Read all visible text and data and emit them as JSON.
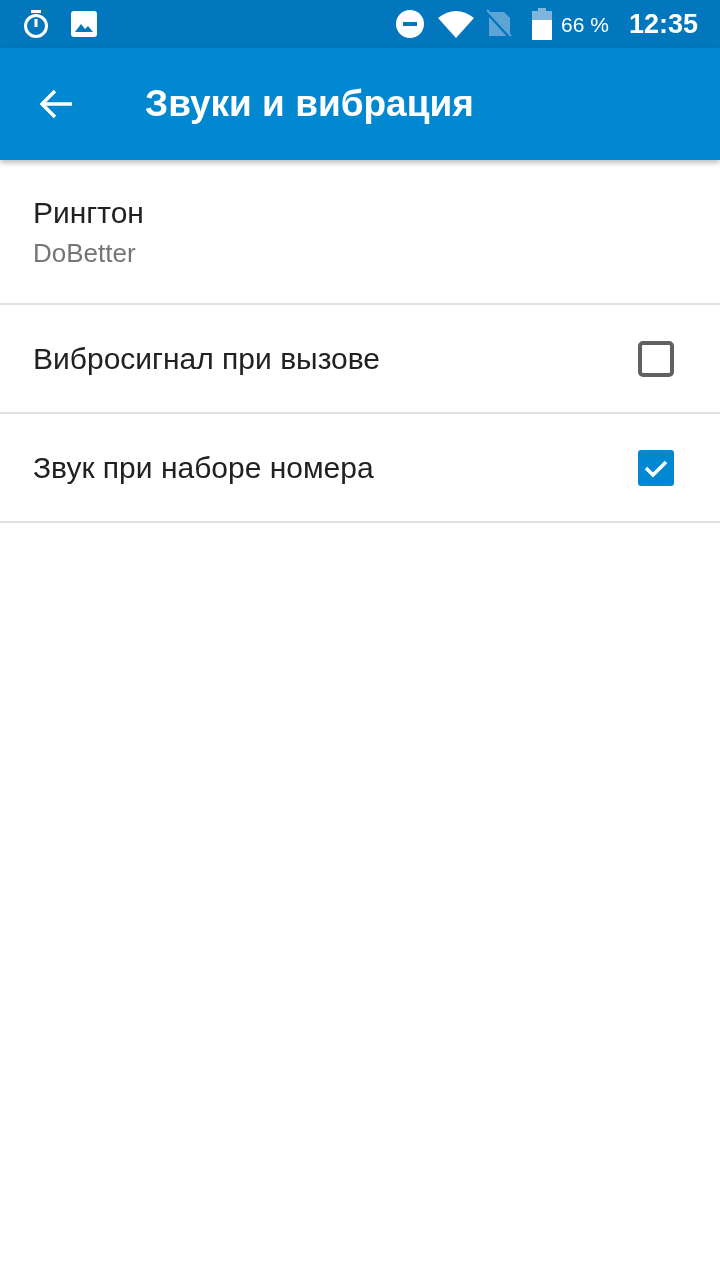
{
  "status_bar": {
    "battery_text": "66 %",
    "time": "12:35"
  },
  "app_bar": {
    "title": "Звуки и вибрация"
  },
  "settings": [
    {
      "kind": "summary",
      "title": "Рингтон",
      "summary": "DoBetter"
    },
    {
      "kind": "checkbox",
      "title": "Вибросигнал при вызове",
      "checked": false
    },
    {
      "kind": "checkbox",
      "title": "Звук при наборе номера",
      "checked": true
    }
  ]
}
